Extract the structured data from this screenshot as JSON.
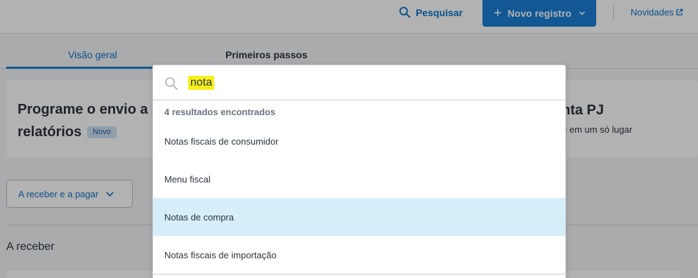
{
  "header": {
    "search_label": "Pesquisar",
    "new_record_label": "Novo registro",
    "news_label": "Novidades"
  },
  "tabs": [
    {
      "label": "Visão geral"
    },
    {
      "label": "Primeiros passos"
    }
  ],
  "promo_left": {
    "title_line1": "Programe o envio a",
    "title_line2": "relatórios",
    "badge": "Novo"
  },
  "promo_right": {
    "title": "nta PJ",
    "subtitle": "e em um só lugar"
  },
  "filter": {
    "label": "A receber e a pagar"
  },
  "section": {
    "title": "A receber"
  },
  "search_popup": {
    "query": "nota",
    "count_text": "4 resultados encontrados",
    "results": [
      {
        "label": "Notas fiscais de consumidor"
      },
      {
        "label": "Menu fiscal"
      },
      {
        "label": "Notas de compra"
      },
      {
        "label": "Notas fiscais de importação"
      }
    ]
  },
  "colors": {
    "accent": "#1b7fd6",
    "link": "#0b73c9",
    "highlight": "#f6ef1b",
    "hover_row": "#d5eefa"
  }
}
